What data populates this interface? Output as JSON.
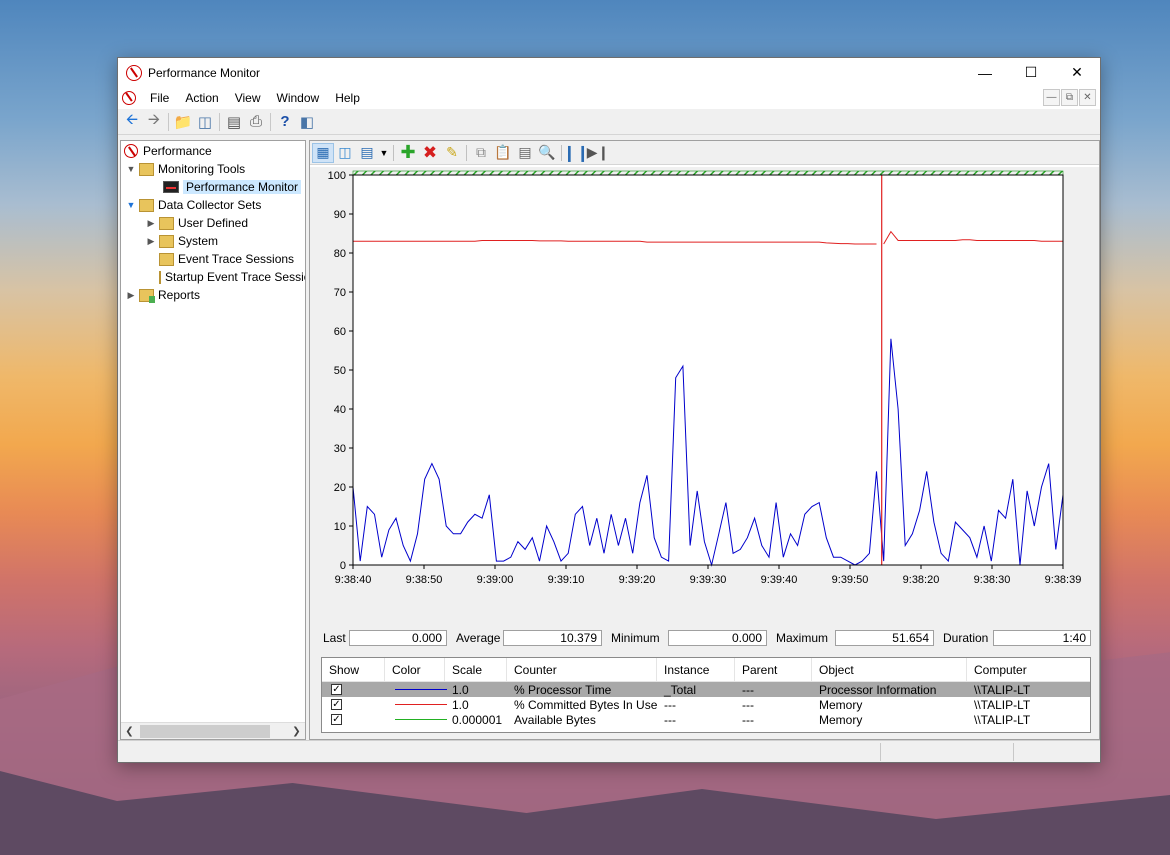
{
  "window": {
    "title": "Performance Monitor"
  },
  "menu": [
    "File",
    "Action",
    "View",
    "Window",
    "Help"
  ],
  "tree": {
    "root": "Performance",
    "monitoring_tools": "Monitoring Tools",
    "performance_monitor": "Performance Monitor",
    "data_collector_sets": "Data Collector Sets",
    "user_defined": "User Defined",
    "system": "System",
    "event_trace_sessions": "Event Trace Sessions",
    "startup_event_trace": "Startup Event Trace Sessions",
    "reports": "Reports"
  },
  "chart_data": {
    "type": "line",
    "ylim": [
      0,
      100
    ],
    "yticks": [
      "0",
      "10",
      "20",
      "30",
      "40",
      "50",
      "60",
      "70",
      "80",
      "90",
      "100"
    ],
    "xticks": [
      "9:38:40",
      "9:38:50",
      "9:39:00",
      "9:39:10",
      "9:39:20",
      "9:39:30",
      "9:39:40",
      "9:39:50",
      "9:38:20",
      "9:38:30",
      "9:38:39"
    ],
    "points": 100,
    "cursor_index": 74,
    "series": [
      {
        "color": "#0000cc",
        "values": [
          20,
          1,
          15,
          13,
          2,
          9,
          12,
          5,
          1,
          8,
          22,
          26,
          22,
          10,
          8,
          8,
          11,
          13,
          12,
          18,
          1,
          1,
          2,
          6,
          4,
          7,
          1,
          10,
          6,
          1,
          3,
          13,
          15,
          5,
          12,
          3,
          13,
          5,
          12,
          3,
          16,
          23,
          7,
          2,
          1,
          48,
          51,
          5,
          19,
          6,
          0,
          8,
          16,
          3,
          4,
          7,
          12,
          5,
          2,
          16,
          2,
          8,
          5,
          13,
          15,
          16,
          7,
          2,
          2,
          1,
          0,
          1,
          3,
          24,
          1,
          58,
          40,
          5,
          8,
          14,
          24,
          11,
          3,
          1,
          11,
          9,
          7,
          2,
          10,
          1,
          14,
          12,
          22,
          0,
          19,
          10,
          20,
          26,
          4,
          18
        ]
      },
      {
        "color": "#e02020",
        "values": [
          83,
          83,
          83,
          83,
          83,
          83,
          83,
          83,
          83,
          83,
          83,
          83,
          83,
          83,
          83,
          83,
          83,
          83,
          83.2,
          83.2,
          83.2,
          83.2,
          83.2,
          83.2,
          83.2,
          83.2,
          83.1,
          83.1,
          83.1,
          83.1,
          83,
          83,
          83,
          83,
          83,
          83,
          83,
          83,
          83,
          83,
          83,
          82.8,
          82.8,
          82.8,
          82.8,
          82.8,
          82.8,
          82.8,
          82.8,
          82.8,
          82.8,
          82.8,
          82.8,
          82.8,
          82.8,
          82.8,
          82.8,
          82.8,
          82.8,
          82.8,
          82.8,
          82.8,
          82.8,
          82.8,
          82.8,
          82.8,
          82.6,
          82.5,
          82.4,
          82.4,
          82.3,
          82.3,
          82.3,
          82.3,
          82.3,
          85.5,
          83.2,
          83.2,
          83.2,
          83.2,
          83.2,
          83.2,
          83.2,
          83.2,
          83.2,
          83.4,
          83.4,
          83.2,
          83.2,
          83.2,
          83.2,
          83.2,
          83.2,
          83.2,
          83.2,
          83.2,
          83,
          83,
          83,
          83
        ]
      },
      {
        "color": "#22b022",
        "values": []
      }
    ]
  },
  "stats": {
    "last_label": "Last",
    "last": "0.000",
    "average_label": "Average",
    "average": "10.379",
    "minimum_label": "Minimum",
    "minimum": "0.000",
    "maximum_label": "Maximum",
    "maximum": "51.654",
    "duration_label": "Duration",
    "duration": "1:40"
  },
  "legend": {
    "headers": [
      "Show",
      "Color",
      "Scale",
      "Counter",
      "Instance",
      "Parent",
      "Object",
      "Computer"
    ],
    "rows": [
      {
        "color": "#0000cc",
        "scale": "1.0",
        "counter": "% Processor Time",
        "instance": "_Total",
        "parent": "---",
        "object": "Processor Information",
        "computer": "\\\\TALIP-LT"
      },
      {
        "color": "#e02020",
        "scale": "1.0",
        "counter": "% Committed Bytes In Use",
        "instance": "---",
        "parent": "---",
        "object": "Memory",
        "computer": "\\\\TALIP-LT"
      },
      {
        "color": "#22b022",
        "scale": "0.000001",
        "counter": "Available Bytes",
        "instance": "---",
        "parent": "---",
        "object": "Memory",
        "computer": "\\\\TALIP-LT"
      }
    ]
  }
}
